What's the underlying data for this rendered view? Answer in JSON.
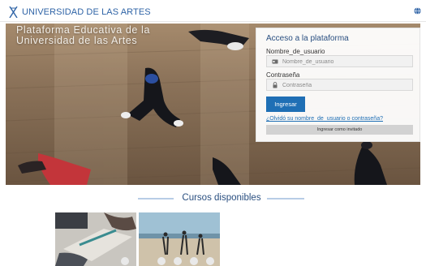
{
  "header": {
    "brand": "UNIVERSIDAD DE LAS ARTES",
    "logo_icon": "x-figure-logo-icon",
    "language_icon": "globe-icon",
    "accent_color": "#2e63a6"
  },
  "hero": {
    "caption": "Plataforma Educativa de la Universidad de las Artes"
  },
  "login": {
    "title": "Acceso a la plataforma",
    "username_label": "Nombre_de_usuario",
    "username_placeholder": "Nombre_de_usuario",
    "username_icon": "id-card-icon",
    "password_label": "Contraseña",
    "password_placeholder": "Contraseña",
    "password_icon": "lock-icon",
    "submit_label": "Ingresar",
    "forgot_link": "¿Olvidó su nombre_de_usuario o contraseña?",
    "guest_label": "Ingresar como invitado",
    "button_color": "#1f6fb5"
  },
  "courses": {
    "heading": "Cursos disponibles"
  }
}
